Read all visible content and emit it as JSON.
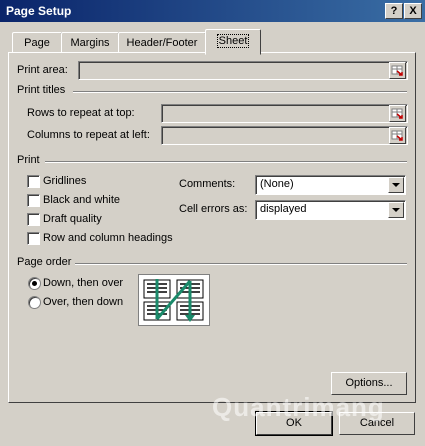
{
  "window": {
    "title": "Page Setup",
    "help_btn": "?",
    "close_btn": "X"
  },
  "tabs": [
    {
      "label": "Page"
    },
    {
      "label": "Margins"
    },
    {
      "label": "Header/Footer"
    },
    {
      "label": "Sheet",
      "active": true
    }
  ],
  "print_area": {
    "label": "Print area:",
    "value": ""
  },
  "print_titles": {
    "heading": "Print titles",
    "rows_label": "Rows to repeat at top:",
    "rows_value": "",
    "cols_label": "Columns to repeat at left:",
    "cols_value": ""
  },
  "print": {
    "heading": "Print",
    "checkboxes": [
      {
        "label": "Gridlines",
        "checked": false
      },
      {
        "label": "Black and white",
        "checked": false
      },
      {
        "label": "Draft quality",
        "checked": false
      },
      {
        "label": "Row and column headings",
        "checked": false
      }
    ],
    "comments_label": "Comments:",
    "comments_value": "(None)",
    "cell_errors_label": "Cell errors as:",
    "cell_errors_value": "displayed"
  },
  "page_order": {
    "heading": "Page order",
    "options": [
      {
        "label": "Down, then over",
        "selected": true
      },
      {
        "label": "Over, then down",
        "selected": false
      }
    ]
  },
  "buttons": {
    "options": "Options...",
    "ok": "OK",
    "cancel": "Cancel"
  },
  "watermark": "Quantrimang",
  "icons": {
    "ref": "range-select-icon",
    "dropdown": "chevron-down-icon"
  }
}
